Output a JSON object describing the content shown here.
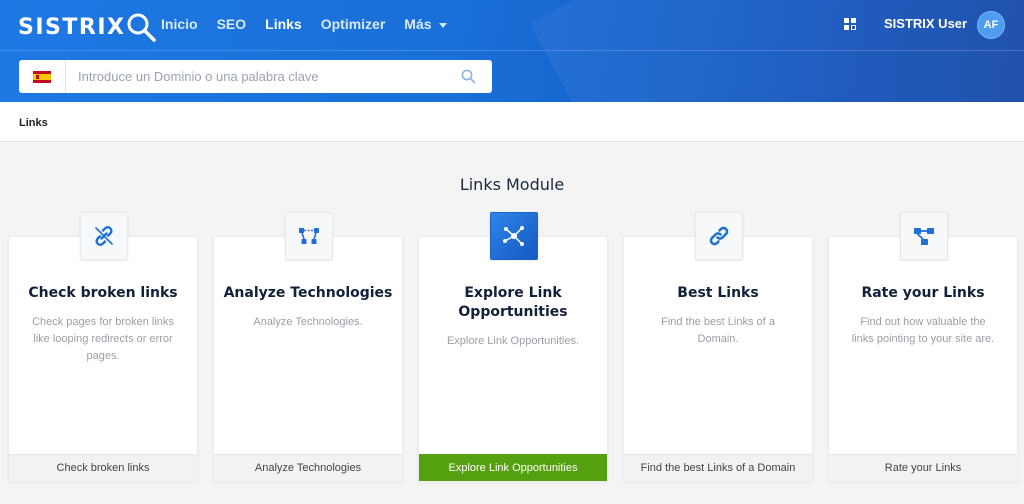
{
  "brand": {
    "logo_text": "SISTRIX"
  },
  "nav": {
    "items": [
      {
        "label": "Inicio",
        "active": false
      },
      {
        "label": "SEO",
        "active": false
      },
      {
        "label": "Links",
        "active": true
      },
      {
        "label": "Optimizer",
        "active": false
      },
      {
        "label": "Más",
        "active": false,
        "has_dropdown": true
      }
    ]
  },
  "user": {
    "name": "SISTRIX User",
    "initials": "AF"
  },
  "search": {
    "country_flag": "spain-flag",
    "placeholder": "Introduce un Dominio o una palabra clave",
    "value": ""
  },
  "breadcrumb": {
    "current": "Links"
  },
  "module": {
    "title": "Links Module"
  },
  "cards": [
    {
      "title": "Check broken links",
      "description": "Check pages for broken links like looping redirects or error pages.",
      "button": "Check broken links",
      "icon": "broken-link-icon",
      "highlighted": false
    },
    {
      "title": "Analyze Technologies",
      "description": "Analyze Technologies.",
      "button": "Analyze Technologies",
      "icon": "nodes-icon",
      "highlighted": false
    },
    {
      "title": "Explore Link Opportunities",
      "description": "Explore Link Opportunities.",
      "button": "Explore Link Opportunities",
      "icon": "network-icon",
      "highlighted": true
    },
    {
      "title": "Best Links",
      "description": "Find the best Links of a Domain.",
      "button": "Find the best Links of a Domain",
      "icon": "link-icon",
      "highlighted": false
    },
    {
      "title": "Rate your Links",
      "description": "Find out how valuable the links pointing to your site are.",
      "button": "Rate your Links",
      "icon": "hierarchy-icon",
      "highlighted": false
    }
  ],
  "colors": {
    "header": "#1a6fd8",
    "accent": "#1e78e3",
    "primary_button": "#54a00f",
    "title": "#11213a"
  }
}
